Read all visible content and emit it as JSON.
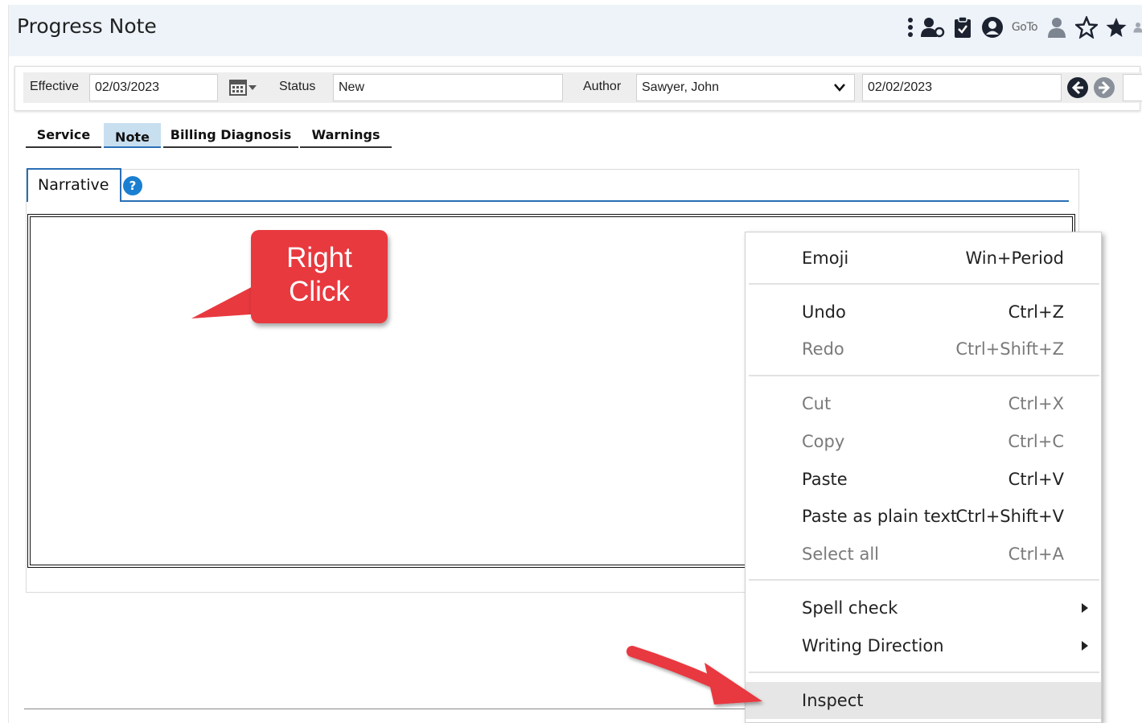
{
  "header": {
    "title": "Progress Note",
    "goto_label": "GoTo"
  },
  "filters": {
    "effective_label": "Effective",
    "effective_value": "02/03/2023",
    "status_label": "Status",
    "status_value": "New",
    "author_label": "Author",
    "author_value": "Sawyer, John",
    "date_value": "02/02/2023"
  },
  "tabs": [
    {
      "label": "Service"
    },
    {
      "label": "Note"
    },
    {
      "label": "Billing Diagnosis"
    },
    {
      "label": "Warnings"
    }
  ],
  "narrative": {
    "tab_label": "Narrative",
    "help_glyph": "?"
  },
  "callout": {
    "line1": "Right",
    "line2": "Click"
  },
  "context_menu": {
    "items": [
      {
        "label": "Emoji",
        "shortcut": "Win+Period"
      },
      {
        "label": "Undo",
        "shortcut": "Ctrl+Z"
      },
      {
        "label": "Redo",
        "shortcut": "Ctrl+Shift+Z"
      },
      {
        "label": "Cut",
        "shortcut": "Ctrl+X"
      },
      {
        "label": "Copy",
        "shortcut": "Ctrl+C"
      },
      {
        "label": "Paste",
        "shortcut": "Ctrl+V"
      },
      {
        "label": "Paste as plain text",
        "shortcut": "Ctrl+Shift+V"
      },
      {
        "label": "Select all",
        "shortcut": "Ctrl+A"
      },
      {
        "label": "Spell check",
        "shortcut": ""
      },
      {
        "label": "Writing Direction",
        "shortcut": ""
      },
      {
        "label": "Inspect",
        "shortcut": ""
      }
    ]
  },
  "colors": {
    "accent": "#2a6fb5",
    "callout": "#e8393f",
    "titlebar": "#edf3f9"
  }
}
